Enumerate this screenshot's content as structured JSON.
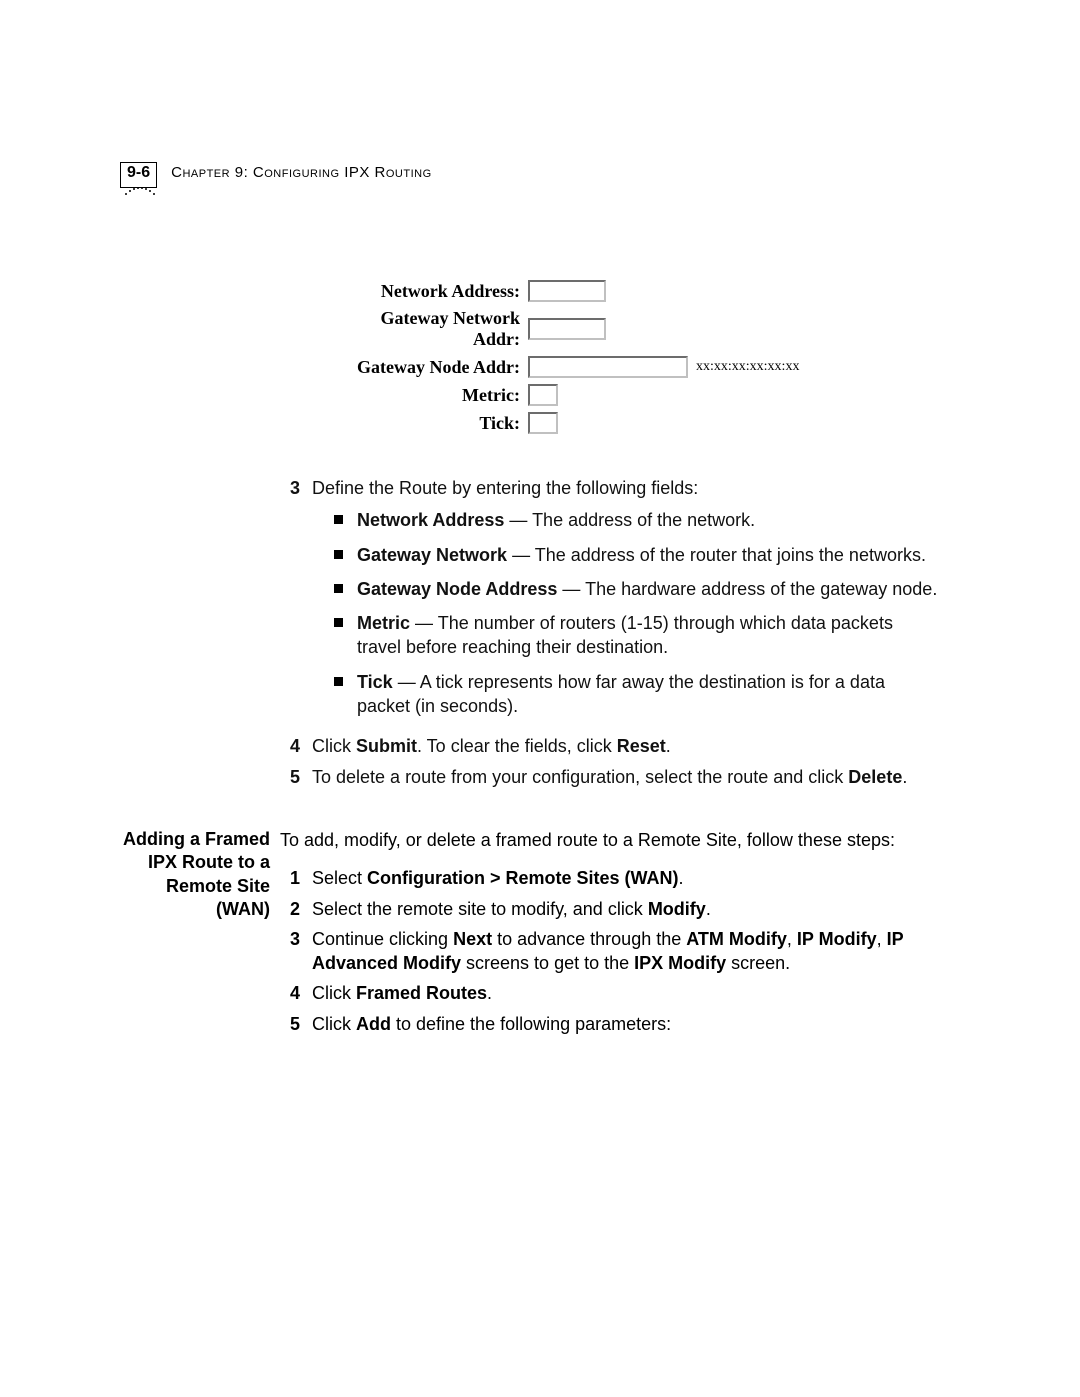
{
  "header": {
    "page_number": "9-6",
    "chapter_label": "Chapter 9: Configuring IPX Routing"
  },
  "form": {
    "rows": {
      "network_address": {
        "label": "Network Address:"
      },
      "gateway_net": {
        "label": "Gateway Network Addr:"
      },
      "gateway_node": {
        "label": "Gateway Node Addr:",
        "hint": "xx:xx:xx:xx:xx:xx"
      },
      "metric": {
        "label": "Metric:"
      },
      "tick": {
        "label": "Tick:"
      }
    }
  },
  "steps_a": {
    "s3": {
      "num": "3",
      "intro": "Define the Route by entering the following fields:",
      "bullets": [
        {
          "term": "Network Address",
          "sep": " — ",
          "desc": "The address of the network."
        },
        {
          "term": "Gateway Network",
          "sep": " — ",
          "desc": "The address of the router that joins the networks."
        },
        {
          "term": "Gateway Node Address",
          "sep": " — ",
          "desc": "The hardware address of the gateway node."
        },
        {
          "term": "Metric",
          "sep": " — ",
          "desc": "The number of routers (1-15) through which data packets travel before reaching their destination."
        },
        {
          "term": "Tick",
          "sep": " — ",
          "desc": "A tick represents how far away the destination is for a data packet (in seconds)."
        }
      ]
    },
    "s4": {
      "num": "4",
      "pre": "Click ",
      "b1": "Submit",
      "mid": ". To clear the fields, click ",
      "b2": "Reset",
      "post": "."
    },
    "s5": {
      "num": "5",
      "pre": "To delete a route from your configuration, select the route and click ",
      "b1": "Delete",
      "post": "."
    }
  },
  "section_title": "Adding a Framed IPX Route to a Remote Site (WAN)",
  "content2": {
    "intro": "To add, modify, or delete a framed route to a Remote Site, follow these steps:",
    "s1": {
      "num": "1",
      "pre": "Select ",
      "b1": "Configuration > Remote Sites (WAN)",
      "post": "."
    },
    "s2": {
      "num": "2",
      "pre": "Select the remote site to modify, and click ",
      "b1": "Modify",
      "post": "."
    },
    "s3": {
      "num": "3",
      "pre": "Continue clicking ",
      "b1": "Next",
      "mid1": " to advance through the ",
      "b2": "ATM Modify",
      "mid2": ", ",
      "b3": "IP Modify",
      "mid3": ", ",
      "b4": "IP Advanced Modify",
      "mid4": " screens to get to the ",
      "b5": "IPX Modify",
      "post": " screen."
    },
    "s4": {
      "num": "4",
      "pre": "Click ",
      "b1": "Framed Routes",
      "post": "."
    },
    "s5": {
      "num": "5",
      "pre": "Click ",
      "b1": "Add",
      "post": " to define the following parameters:"
    }
  }
}
